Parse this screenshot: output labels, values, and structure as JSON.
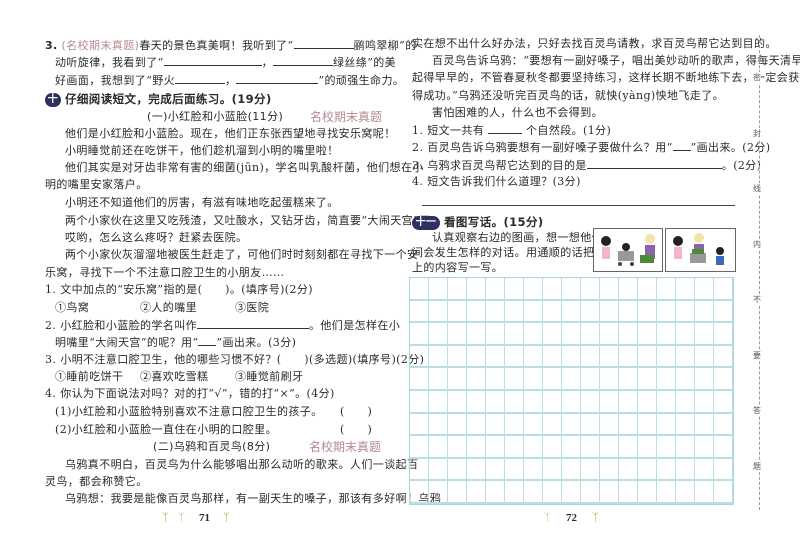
{
  "left_page": {
    "q3": {
      "num": "3.",
      "tag": "(名校期末真题)",
      "l1a": "春天的景色真美啊！我听到了“",
      "l1b": "鹂鸣翠柳”的",
      "l2a": "动听旋律，我看到了“",
      "l2b": "，",
      "l2c": "绿丝绦”的美",
      "l3a": "好画面，我想到了“野火",
      "l3b": "，",
      "l3c": "”的顽强生命力。"
    },
    "section10": {
      "num": "十",
      "title": "仔细阅读短文，完成后面练习。(19分)"
    },
    "passage1": {
      "title": "(一)小红脸和小蓝脸(11分)",
      "tag": "名校期末真题",
      "lines": [
        "他们是小红脸和小蓝脸。现在，他们正东张西望地寻找安乐窝呢！",
        "小明睡觉前还在吃饼干，他们趁机溜到小明的嘴里啦！",
        "他们其实是对牙齿非常有害的细菌(jūn)，学名叫乳酸杆菌，他们想在小",
        "明的嘴里安家落户。",
        "小明还不知道他们的厉害，有滋有味地吃起蛋糕来了。",
        "两个小家伙在这里又吃残渣，又吐酸水，又钻牙齿，简直要“大闹天宫”了。",
        "哎哟，怎么这么疼呀？赶紧去医院。",
        "两个小家伙灰溜溜地被医生赶走了，可他们时时刻刻都在寻找下一个安",
        "乐窝，寻找下一个不注意口腔卫生的小朋友……"
      ],
      "questions": {
        "q1": "1. 文中加点的“安乐窝”指的是(　　)。(填序号)(2分)",
        "q1_options": [
          "①鸟窝",
          "②人的嘴里",
          "③医院"
        ],
        "q2a": "2. 小红脸和小蓝脸的学名叫作",
        "q2b": "。他们是怎样在小",
        "q2c": "明嘴里“大闹天宫”的呢？用“",
        "q2d": "”画出来。(3分)",
        "q3": "3. 小明不注意口腔卫生，他的哪些习惯不好？(　　)(多选题)(填序号)(2分)",
        "q3_options": [
          "①睡前吃饼干",
          "②喜欢吃雪糕",
          "③睡觉前刷牙"
        ],
        "q4": "4. 你认为下面说法对吗？对的打“√”，错的打“×”。(4分)",
        "q4_items": [
          "(1)小红脸和小蓝脸特别喜欢不注意口腔卫生的孩子。",
          "(2)小红脸和小蓝脸一直住在小明的口腔里。"
        ],
        "paren": "(　　)"
      }
    },
    "passage2": {
      "title": "(二)乌鸦和百灵鸟(8分)",
      "tag": "名校期末真题",
      "lines": [
        "乌鸦真不明白，百灵鸟为什么能够唱出那么动听的歌来。人们一谈起百",
        "灵鸟，都会称赞它。",
        "乌鸦想：我要是能像百灵鸟那样，有一副天生的嗓子，那该有多好啊！乌鸦"
      ]
    },
    "page_number": "71"
  },
  "right_page": {
    "passage2_cont": [
      "实在想不出什么好办法，只好去找百灵鸟请教，求百灵鸟帮它达到目的。",
      "百灵鸟告诉乌鸦：“要想有一副好嗓子，唱出美妙动听的歌声，得每天清早",
      "起得早早的，不管春夏秋冬都要坚持练习，这样长期不断地练下去，一定会获",
      "得成功。”乌鸦还没听完百灵鸟的话，就怏(yàng)怏地飞走了。",
      "害怕困难的人，什么也不会得到。"
    ],
    "questions": {
      "q1a": "1. 短文一共有",
      "q1b": "个自然段。(1分)",
      "q2a": "2. 百灵鸟告诉乌鸦要想有一副好嗓子要做什么？用“",
      "q2b": "”画出来。(2分)",
      "q3a": "3. 乌鸦求百灵鸟帮它达到的目的是",
      "q3b": "。(2分)",
      "q4": "4. 短文告诉我们什么道理？(3分)"
    },
    "section11": {
      "num": "十一",
      "title": "看图写话。(15分)",
      "lines": [
        "认真观察右边的图画，想一想他们之",
        "间会发生怎样的对话。用通顺的话把图画",
        "上的内容写一写。"
      ]
    },
    "writing_grid": {
      "columns": 17,
      "rows": 10
    },
    "page_number": "72",
    "margin_chars": [
      "密",
      "封",
      "线",
      "内",
      "不",
      "要",
      "答",
      "题"
    ]
  }
}
